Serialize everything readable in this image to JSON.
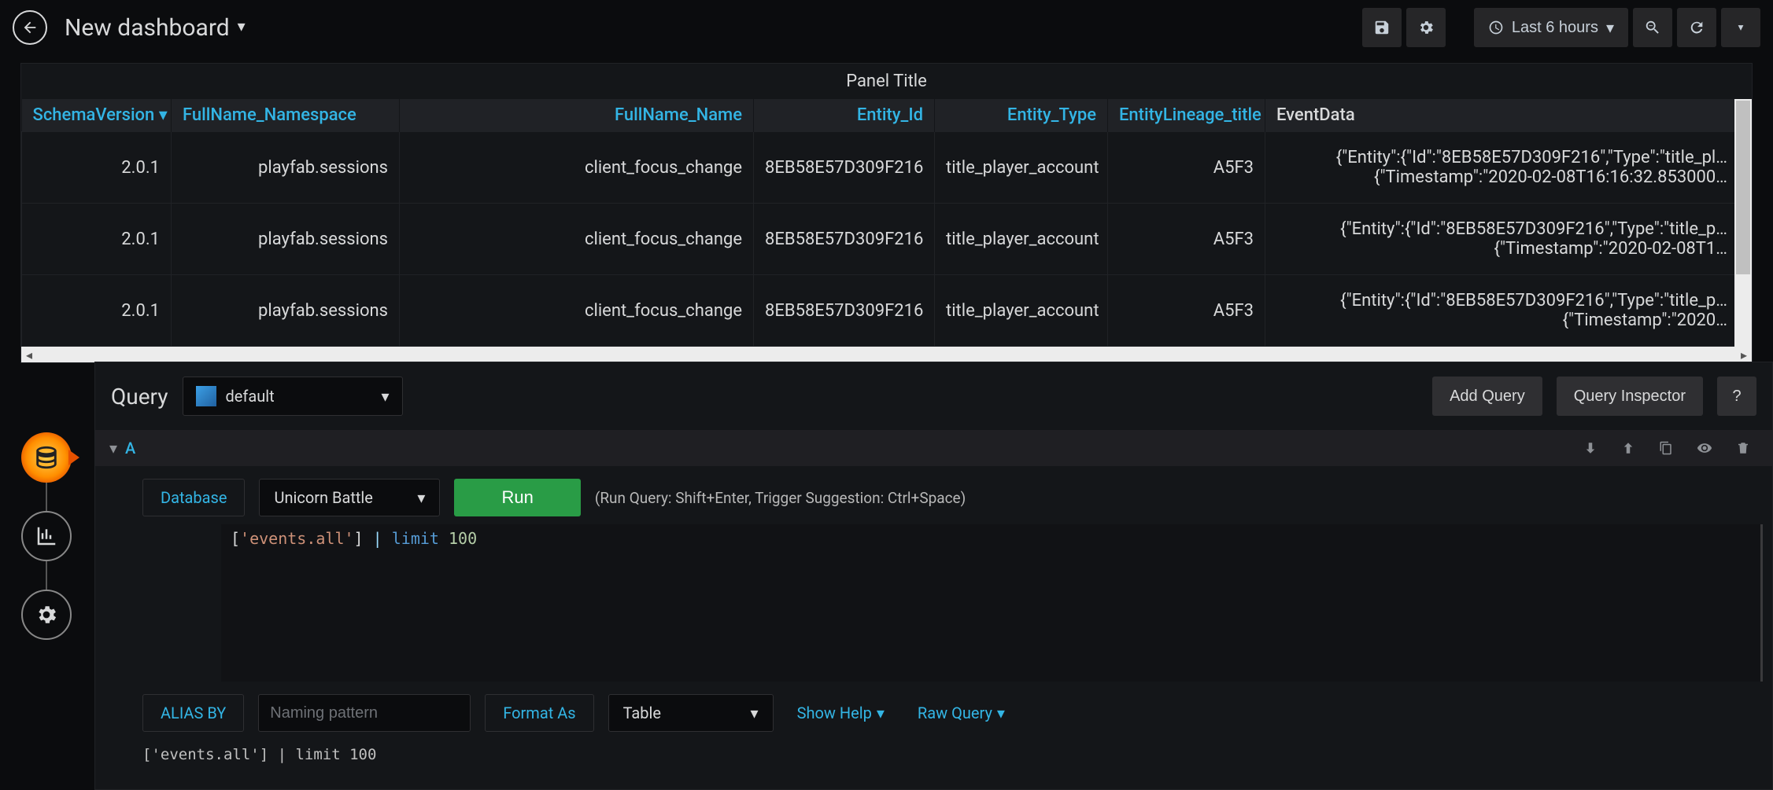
{
  "nav": {
    "title": "New dashboard",
    "time_label": "Last 6 hours"
  },
  "panel": {
    "title": "Panel Title",
    "columns": [
      "SchemaVersion",
      "FullName_Namespace",
      "FullName_Name",
      "Entity_Id",
      "Entity_Type",
      "EntityLineage_title",
      "EventData"
    ],
    "rows": [
      {
        "SchemaVersion": "2.0.1",
        "FullName_Namespace": "playfab.sessions",
        "FullName_Name": "client_focus_change",
        "Entity_Id": "8EB58E57D309F216",
        "Entity_Type": "title_player_account",
        "EntityLineage_title": "A5F3",
        "EventData": "{\"Entity\":{\"Id\":\"8EB58E57D309F216\",\"Type\":\"title_pl…\n{\"Timestamp\":\"2020-02-08T16:16:32.853000…"
      },
      {
        "SchemaVersion": "2.0.1",
        "FullName_Namespace": "playfab.sessions",
        "FullName_Name": "client_focus_change",
        "Entity_Id": "8EB58E57D309F216",
        "Entity_Type": "title_player_account",
        "EntityLineage_title": "A5F3",
        "EventData": "{\"Entity\":{\"Id\":\"8EB58E57D309F216\",\"Type\":\"title_p…\n{\"Timestamp\":\"2020-02-08T1…"
      },
      {
        "SchemaVersion": "2.0.1",
        "FullName_Namespace": "playfab.sessions",
        "FullName_Name": "client_focus_change",
        "Entity_Id": "8EB58E57D309F216",
        "Entity_Type": "title_player_account",
        "EntityLineage_title": "A5F3",
        "EventData": "{\"Entity\":{\"Id\":\"8EB58E57D309F216\",\"Type\":\"title_p…\n{\"Timestamp\":\"2020…"
      }
    ],
    "hscroll_thumb_pct": 27
  },
  "editor": {
    "section_label": "Query",
    "datasource": "default",
    "add_query": "Add Query",
    "inspector": "Query Inspector",
    "help_glyph": "?",
    "row_letter": "A",
    "database_label": "Database",
    "database_value": "Unicorn Battle",
    "run_label": "Run",
    "run_hint": "(Run Query: Shift+Enter, Trigger Suggestion: Ctrl+Space)",
    "code_string": "'events.all'",
    "code_kw": "limit",
    "code_num": "100",
    "alias_label": "ALIAS BY",
    "alias_placeholder": "Naming pattern",
    "format_label": "Format As",
    "format_value": "Table",
    "show_help": "Show Help",
    "raw_query": "Raw Query",
    "raw_line": "['events.all'] | limit 100"
  }
}
